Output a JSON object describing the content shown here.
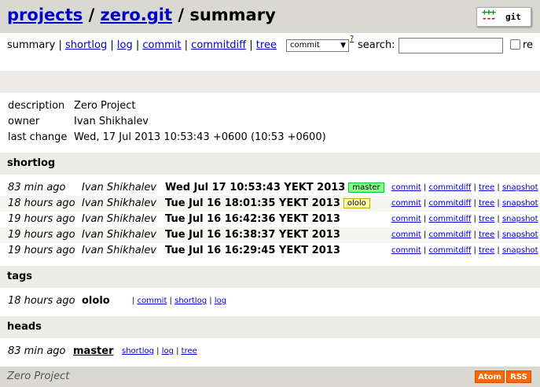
{
  "header": {
    "crumb_projects": "projects",
    "sep1": "/",
    "crumb_repo": "zero.git",
    "sep2": "/",
    "crumb_current": "summary",
    "logo_text": "git",
    "logo_plus": "+++",
    "logo_minus": "---"
  },
  "nav": {
    "current": "summary",
    "links": [
      "shortlog",
      "log",
      "commit",
      "commitdiff",
      "tree"
    ],
    "separator": "|",
    "search_type": "commit",
    "help": "?",
    "search_label": "search:",
    "search_value": "",
    "regex_label": "re"
  },
  "project": {
    "rows": [
      {
        "key": "description",
        "value": "Zero Project"
      },
      {
        "key": "owner",
        "value": "Ivan Shikhalev"
      },
      {
        "key": "last change",
        "value": "Wed, 17 Jul 2013 10:53:43 +0600 (10:53 +0600)"
      }
    ]
  },
  "shortlog": {
    "title": "shortlog",
    "actions": [
      "commit",
      "commitdiff",
      "tree",
      "snapshot"
    ],
    "rows": [
      {
        "age": "83 min ago",
        "author": "Ivan Shikhalev",
        "subject": "Wed Jul 17 10:53:43 YEKT 2013",
        "badge": "master",
        "badge_kind": "head"
      },
      {
        "age": "18 hours ago",
        "author": "Ivan Shikhalev",
        "subject": "Tue Jul 16 18:01:35 YEKT 2013",
        "badge": "ololo",
        "badge_kind": "tag"
      },
      {
        "age": "19 hours ago",
        "author": "Ivan Shikhalev",
        "subject": "Tue Jul 16 16:42:36 YEKT 2013",
        "badge": "",
        "badge_kind": ""
      },
      {
        "age": "19 hours ago",
        "author": "Ivan Shikhalev",
        "subject": "Tue Jul 16 16:38:37 YEKT 2013",
        "badge": "",
        "badge_kind": ""
      },
      {
        "age": "19 hours ago",
        "author": "Ivan Shikhalev",
        "subject": "Tue Jul 16 16:29:45 YEKT 2013",
        "badge": "",
        "badge_kind": ""
      }
    ]
  },
  "tags": {
    "title": "tags",
    "rows": [
      {
        "age": "18 hours ago",
        "name": "ololo",
        "links": [
          "commit",
          "shortlog",
          "log"
        ]
      }
    ]
  },
  "heads": {
    "title": "heads",
    "rows": [
      {
        "age": "83 min ago",
        "name": "master",
        "links": [
          "shortlog",
          "log",
          "tree"
        ]
      }
    ]
  },
  "footer": {
    "description": "Zero Project",
    "atom": "Atom",
    "rss": "RSS"
  },
  "colors": {
    "header_bg": "#d9d8d1",
    "section_bg": "#edece6",
    "link": "#0000cc",
    "head_badge": "#88ff88",
    "tag_badge": "#ffffaa",
    "feed_button": "#ff6600"
  }
}
